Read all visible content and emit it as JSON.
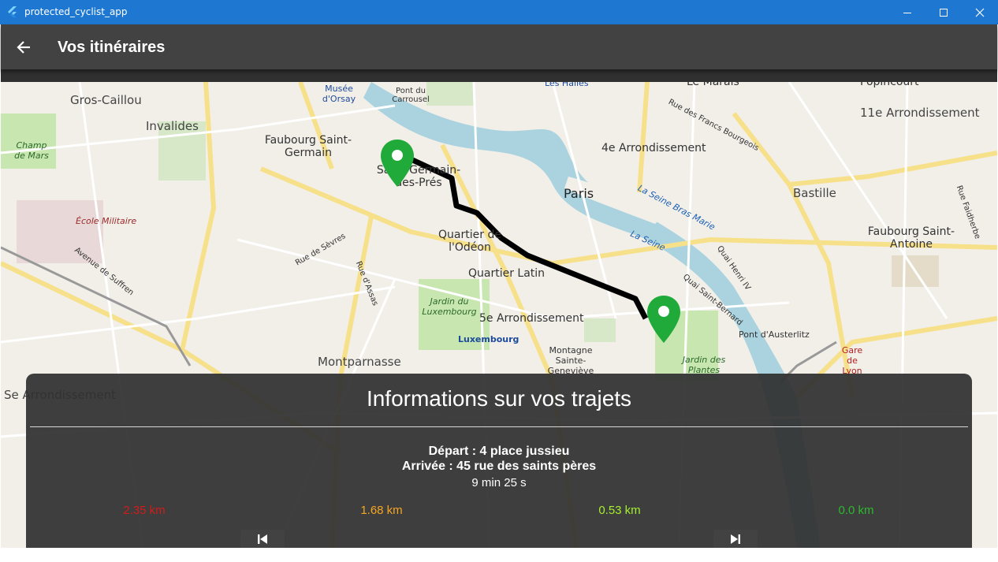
{
  "window": {
    "title": "protected_cyclist_app",
    "controls": [
      "minimize-icon",
      "maximize-icon",
      "close-icon"
    ]
  },
  "appbar": {
    "back_icon": "arrow-left-icon",
    "title": "Vos itinéraires"
  },
  "map": {
    "labels": {
      "gros_caillou": "Gros-Caillou",
      "invalides": "Invalides",
      "champ_de_mars": "Champ de Mars",
      "faubourg_saint_germain": "Faubourg Saint-Germain",
      "musee_orsay": "Musée d'Orsay",
      "pont_carrousel": "Pont du Carrousel",
      "les_halles": "Les Halles",
      "le_marais": "Le Marais",
      "popincourt": "Popincourt",
      "arr11": "11e Arrondissement",
      "arr4": "4e Arrondissement",
      "rue_francs_bourgeois": "Rue des Francs Bourgeois",
      "saint_germain_des_pres": "Saint-Germain-des-Prés",
      "paris": "Paris",
      "bastille": "Bastille",
      "la_seine_bras_marie": "La Seine Bras Marie",
      "la_seine": "La Seine",
      "faubourg_saint_antoine": "Faubourg Saint-Antoine",
      "ecole_militaire": "École Militaire",
      "rue_de_sevres": "Rue de Sèvres",
      "quartier_odeon": "Quartier de l'Odéon",
      "quartier_latin": "Quartier Latin",
      "avenue_suffren": "Avenue de Suffren",
      "rue_assas": "Rue d'Assas",
      "quai_henri": "Quai Henri IV",
      "quai_saint_bernard": "Quai Saint-Bernard",
      "jardin_luxembourg": "Jardin du Luxembourg",
      "arr5": "5e Arrondissement",
      "luxembourg": "Luxembourg",
      "montagne_genevieve": "Montagne Sainte-Geneviève",
      "pont_austerlitz": "Pont d'Austerlitz",
      "gare_de_lyon": "Gare de Lyon",
      "jardin_plantes": "Jardin des Plantes",
      "montparnasse": "Montparnasse",
      "rue_faidherbe": "Rue Faidherbe",
      "arr7": "Se Arrondissement"
    },
    "start_marker_icon": "map-pin-icon",
    "end_marker_icon": "map-pin-icon"
  },
  "panel": {
    "title": "Informations sur vos trajets",
    "depart": "Départ : 4 place jussieu",
    "arrivee": "Arrivée : 45 rue des saints pères",
    "duree": "9 min 25 s",
    "distances": [
      {
        "value": "2.35 km",
        "color": "#d01c1c"
      },
      {
        "value": "1.68 km",
        "color": "#f5a623"
      },
      {
        "value": "0.53 km",
        "color": "#a4ef2e"
      },
      {
        "value": "0.0 km",
        "color": "#2db82d"
      }
    ],
    "prev_icon": "skip-previous-icon",
    "next_icon": "skip-next-icon"
  },
  "colors": {
    "titlebar": "#1e78d2",
    "appbar": "#424242",
    "panel": "#303030",
    "marker": "#1faa3a",
    "route": "#000000"
  }
}
